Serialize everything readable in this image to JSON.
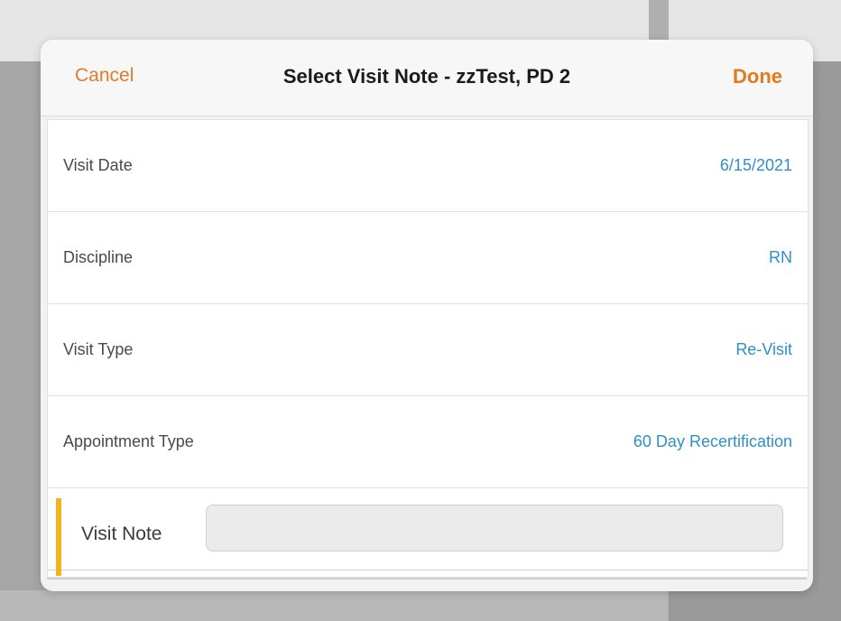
{
  "modal": {
    "cancel_label": "Cancel",
    "title": "Select Visit Note - zzTest, PD 2",
    "done_label": "Done"
  },
  "form": {
    "rows": [
      {
        "label": "Visit Date",
        "value": "6/15/2021"
      },
      {
        "label": "Discipline",
        "value": "RN"
      },
      {
        "label": "Visit Type",
        "value": "Re-Visit"
      },
      {
        "label": "Appointment Type",
        "value": "60 Day Recertification"
      }
    ],
    "visit_note": {
      "label": "Visit Note",
      "value": ""
    }
  },
  "colors": {
    "accent_orange": "#e07a1e",
    "value_blue": "#2f8fc7",
    "required_marker": "#f2b31c"
  }
}
